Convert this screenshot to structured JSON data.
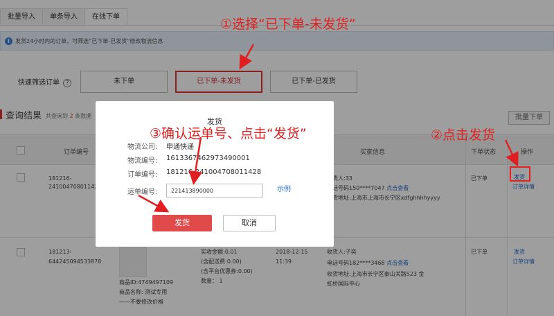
{
  "tabs": [
    "批量导入",
    "单条导入",
    "在线下单"
  ],
  "info_text": "发货24小时内的订单，可筛选“已下单-已发货”修改物流信息",
  "filter": {
    "label": "快速筛选订单",
    "buttons": [
      "未下单",
      "已下单-未发货",
      "已下单-已发货"
    ]
  },
  "results": {
    "title": "查询结果",
    "count_prefix": "共查询到",
    "count": "2",
    "count_suffix": "条数据",
    "batch_label": "批量下单"
  },
  "table": {
    "headers": [
      "订单编号",
      "买家信息",
      "下单状态",
      "操作"
    ],
    "rows": [
      {
        "order_no_1": "181216-",
        "order_no_2": "24100470801142",
        "buyer_1": "收货人:33",
        "buyer_2": "电话号码150****7047",
        "buyer_2_link": "点击查看",
        "buyer_3": "收货地址:上海市上海市长宁区xdfghhhhyyyy",
        "status": "已下单",
        "action_1": "发货",
        "action_2": "订单详情"
      },
      {
        "order_no_1": "181213-",
        "order_no_2": "644245094533878",
        "product_id": "商品ID:4749497109",
        "product_name": "商品名称: 测试专用",
        "product_note": "——不要修改价格",
        "amount": "实收金额:0.01",
        "shipping": "(含配送费:0.00)",
        "discount": "(含平台优惠券:0.00)",
        "qty": "数量：  1",
        "date": "2018-12-15",
        "time": "11:39",
        "buyer_1": "收货人:子奕",
        "buyer_2": "电话号码182****3468",
        "buyer_2_link": "点击查看",
        "buyer_3": "收货地址:上海市长宁区泰山关路523 金",
        "buyer_4": "虹桥国际中心",
        "status": "已下单",
        "action_1": "发货",
        "action_2": "订单详情"
      }
    ]
  },
  "modal": {
    "title": "发货",
    "company_label": "物流公司:",
    "company_value": "申通快递",
    "logistics_no_label": "物流编号:",
    "logistics_no_value": "1613367462973490001",
    "order_no_label": "订单编号:",
    "order_no_value": "181216-241004708011428",
    "waybill_label": "运单编号:",
    "waybill_value": "221413890000",
    "example_label": "示例",
    "ship_label": "发货",
    "cancel_label": "取消"
  },
  "annotations": {
    "step1": "①选择“已下单-未发货”",
    "step2": "②点击发货",
    "step3": "③确认运单号、点击“发货”"
  },
  "colors": {
    "accent_red": "#e02020",
    "primary_btn": "#e04a4a",
    "link_blue": "#2a6fc8"
  }
}
